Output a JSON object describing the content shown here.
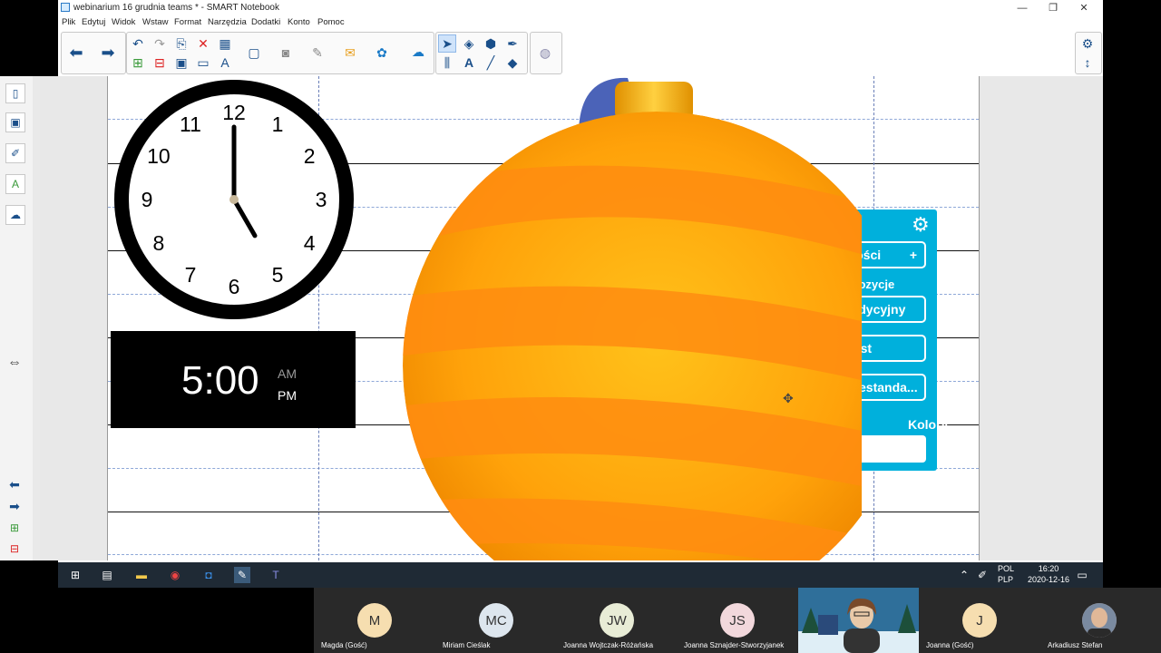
{
  "window": {
    "title": "webinarium 16 grudnia teams * - SMART Notebook",
    "controls": [
      "—",
      "❐",
      "✕"
    ]
  },
  "menu": [
    "Plik",
    "Edytuj",
    "Widok",
    "Wstaw",
    "Format",
    "Narzędzia",
    "Dodatki",
    "Konto",
    "Pomoc"
  ],
  "toolbar": {
    "icons": [
      "arrow-back-icon",
      "arrow-forward-icon",
      "undo-icon",
      "redo-icon",
      "delete-icon",
      "table-icon",
      "screen-shade-icon",
      "camera-icon",
      "pin-icon",
      "mail-icon",
      "addon-icon",
      "activity-icon",
      "select-icon",
      "shapes-icon",
      "fill-icon",
      "pen-icon",
      "text-icon",
      "line-icon",
      "eraser-icon",
      "magic-pen-icon",
      "settings-icon",
      "move-toolbar-icon"
    ]
  },
  "clock": {
    "numbers": [
      "12",
      "1",
      "2",
      "3",
      "4",
      "5",
      "6",
      "7",
      "8",
      "9",
      "10",
      "11"
    ],
    "hour": 5,
    "minute": 0
  },
  "digital_clock": {
    "time": "5:00",
    "am": "AM",
    "pm": "PM"
  },
  "widget_panel": {
    "button_dice": "Kości",
    "button_dice_plus": "+",
    "heading_compositions": "ompozycje",
    "button_traditional": "radycyjny",
    "button_text": "ekst",
    "button_custom": "Niestanda...",
    "heading_colors": "Kolory"
  },
  "taskbar": {
    "lang_top": "POL",
    "lang_bottom": "PLP",
    "time": "16:20",
    "date": "2020-12-16"
  },
  "participants": [
    {
      "initials": "M",
      "name": "Magda (Gość)",
      "color": "#f6deb0"
    },
    {
      "initials": "MC",
      "name": "Miriam Cieślak",
      "color": "#dde6ee"
    },
    {
      "initials": "JW",
      "name": "Joanna Wojtczak-Różańska",
      "color": "#e8ecd6"
    },
    {
      "initials": "JS",
      "name": "Joanna Sznajder-Stworzyjanek",
      "color": "#f2d8dc"
    },
    {
      "initials": "",
      "name": "",
      "color": "#6aa8c8"
    },
    {
      "initials": "J",
      "name": "Joanna (Gość)",
      "color": "#f6deb0"
    },
    {
      "initials": "",
      "name": "Arkadiusz Stefan",
      "color": "#555"
    }
  ]
}
